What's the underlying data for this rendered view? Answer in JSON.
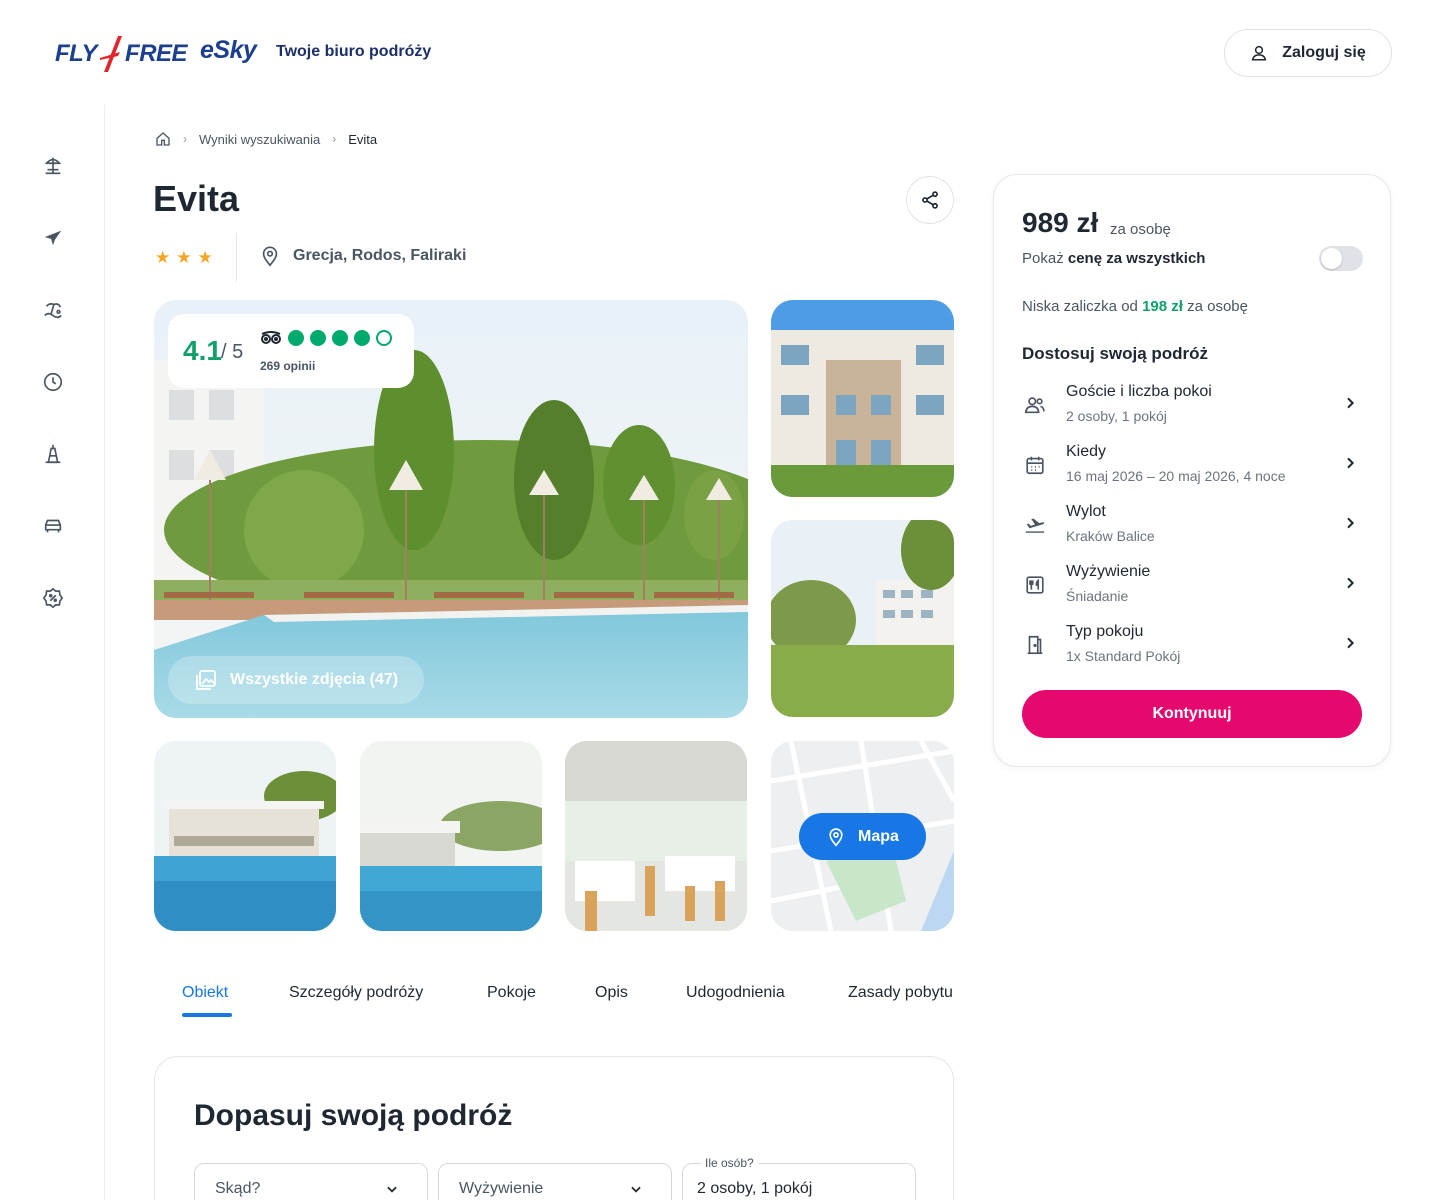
{
  "header": {
    "logo_fly": "FLY",
    "logo_free": "FREE",
    "logo_esky": "eSky",
    "tagline": "Twoje biuro podróży",
    "login_label": "Zaloguj się"
  },
  "sidebar": {
    "items": [
      {
        "icon": "beach-umbrella-icon"
      },
      {
        "icon": "plane-icon"
      },
      {
        "icon": "island-icon"
      },
      {
        "icon": "clock-icon"
      },
      {
        "icon": "eiffel-tower-icon"
      },
      {
        "icon": "car-icon"
      },
      {
        "icon": "discount-badge-icon"
      }
    ]
  },
  "breadcrumb": {
    "home_icon": "home-icon",
    "items": [
      "Wyniki wyszukiwania",
      "Evita"
    ]
  },
  "hotel": {
    "name": "Evita",
    "stars": 3,
    "location": "Grecja, Rodos, Faliraki"
  },
  "rating": {
    "score": "4.1",
    "out_of": "/ 5",
    "tripadvisor_bubbles": 4,
    "reviews": "269 opinii"
  },
  "gallery": {
    "all_photos_label": "Wszystkie zdjęcia (47)",
    "map_label": "Mapa"
  },
  "tabs": [
    "Obiekt",
    "Szczegóły podróży",
    "Pokoje",
    "Opis",
    "Udogodnienia",
    "Zasady pobytu"
  ],
  "active_tab": "Obiekt",
  "customize_form": {
    "title": "Dopasuj swoją podróż",
    "from_placeholder": "Skąd?",
    "meal_placeholder": "Wyżywienie",
    "people_label": "Ile osób?",
    "people_value": "2 osoby, 1 pokój"
  },
  "booking": {
    "price": "989 zł",
    "per_person": "za osobę",
    "show_all_prefix": "Pokaż",
    "show_all_bold": "cenę za wszystkich",
    "show_all_toggle_on": false,
    "deposit_prefix": "Niska zaliczka od",
    "deposit_amount": "198 zł",
    "deposit_suffix": "za osobę",
    "customize_title": "Dostosuj swoją podróż",
    "options": [
      {
        "label": "Goście i liczba pokoi",
        "value": "2 osoby, 1 pokój",
        "icon": "users-icon"
      },
      {
        "label": "Kiedy",
        "value": "16 maj 2026 – 20 maj 2026, 4 noce",
        "icon": "calendar-icon"
      },
      {
        "label": "Wylot",
        "value": "Kraków Balice",
        "icon": "departure-icon"
      },
      {
        "label": "Wyżywienie",
        "value": "Śniadanie",
        "icon": "cutlery-icon"
      },
      {
        "label": "Typ pokoju",
        "value": "1x Standard Pokój",
        "icon": "door-icon"
      }
    ],
    "continue_label": "Kontynuuj"
  },
  "colors": {
    "brand_navy": "#1c3f8f",
    "brand_red": "#e3252b",
    "accent_blue": "#1677e5",
    "cta_pink": "#e5096f",
    "rating_green": "#11a06b",
    "star_orange": "#f5a623"
  }
}
